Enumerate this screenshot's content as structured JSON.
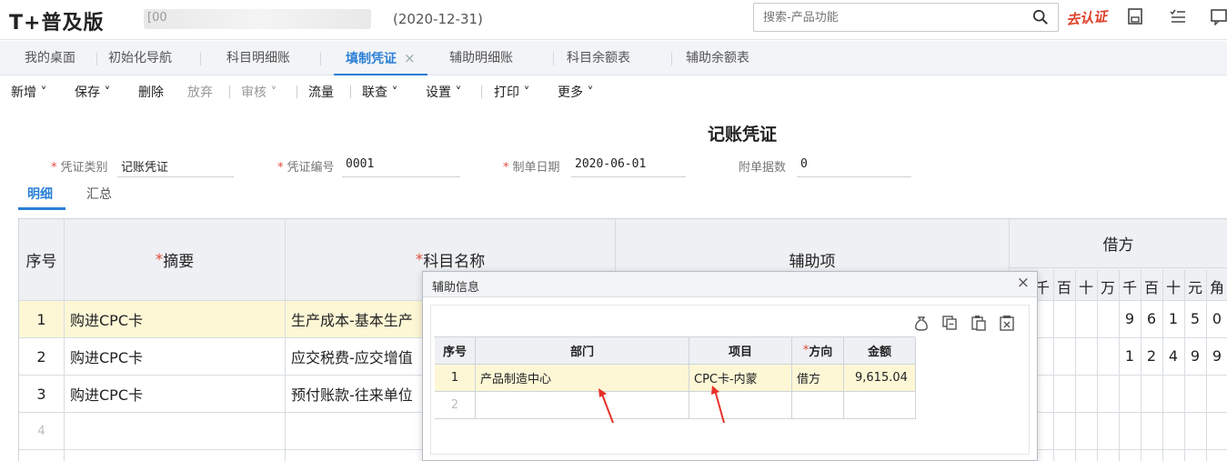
{
  "header": {
    "logo": "T+普及版",
    "company": "[00",
    "date": "(2020-12-31)",
    "search_placeholder": "搜索-产品功能",
    "cert_badge": "去认证",
    "accent_color": "#2a7fd6"
  },
  "tabs": [
    {
      "label": "我的桌面"
    },
    {
      "label": "初始化导航"
    },
    {
      "label": "科目明细账"
    },
    {
      "label": "填制凭证",
      "active": true
    },
    {
      "label": "辅助明细账"
    },
    {
      "label": "科目余额表"
    },
    {
      "label": "辅助余额表"
    }
  ],
  "toolbar": {
    "new": "新增",
    "save": "保存",
    "delete": "删除",
    "discard": "放弃",
    "audit": "审核",
    "flow": "流量",
    "linkquery": "联查",
    "settings": "设置",
    "print": "打印",
    "more": "更多"
  },
  "voucher": {
    "title": "记账凭证",
    "type_label": "凭证类别",
    "type_value": "记账凭证",
    "number_label": "凭证编号",
    "number_value": "0001",
    "date_label": "制单日期",
    "date_value": "2020-06-01",
    "attach_label": "附单据数",
    "attach_value": "0"
  },
  "subtabs": {
    "detail": "明细",
    "summary": "汇总"
  },
  "grid": {
    "headers": {
      "seq": "序号",
      "summary": "摘要",
      "account": "科目名称",
      "aux": "辅助项",
      "debit": "借方"
    },
    "digit_headers": [
      "千",
      "百",
      "十",
      "万",
      "千",
      "百",
      "十",
      "元",
      "角"
    ],
    "rows": [
      {
        "seq": "1",
        "summary": "购进CPC卡",
        "account": "生产成本-基本生产",
        "digits": [
          "",
          "",
          "",
          "",
          "9",
          "6",
          "1",
          "5",
          "0"
        ]
      },
      {
        "seq": "2",
        "summary": "购进CPC卡",
        "account": "应交税费-应交增值",
        "digits": [
          "",
          "",
          "",
          "",
          "1",
          "2",
          "4",
          "9",
          "9"
        ]
      },
      {
        "seq": "3",
        "summary": "购进CPC卡",
        "account": "预付账款-往来单位",
        "digits": [
          "",
          "",
          "",
          "",
          "",
          "",
          "",
          "",
          ""
        ]
      },
      {
        "seq": "4",
        "summary": "",
        "account": "",
        "digits": [
          "",
          "",
          "",
          "",
          "",
          "",
          "",
          "",
          ""
        ]
      }
    ]
  },
  "dialog": {
    "title": "辅助信息",
    "close": "×",
    "columns": {
      "seq": "序号",
      "dept": "部门",
      "project": "项目",
      "direction": "方向",
      "amount": "金额"
    },
    "rows": [
      {
        "seq": "1",
        "dept": "产品制造中心",
        "project": "CPC卡-内蒙",
        "direction": "借方",
        "amount": "9,615.04"
      },
      {
        "seq": "2",
        "dept": "",
        "project": "",
        "direction": "",
        "amount": ""
      }
    ]
  }
}
